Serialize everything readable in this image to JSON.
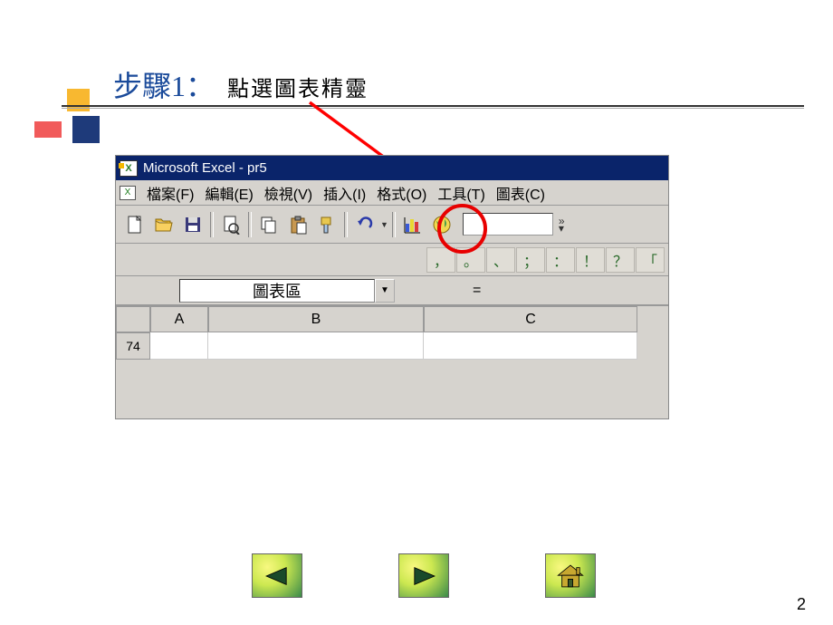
{
  "title": {
    "step": "步驟1：",
    "desc": "點選圖表精靈"
  },
  "excel": {
    "titlebar": "Microsoft Excel - pr5",
    "menu": [
      "檔案(F)",
      "編輯(E)",
      "檢視(V)",
      "插入(I)",
      "格式(O)",
      "工具(T)",
      "圖表(C)"
    ],
    "symbols": [
      "，",
      "。",
      "、",
      "；",
      "：",
      "！",
      "？",
      "「"
    ],
    "namebox": "圖表區",
    "formula_eq": "=",
    "columns": [
      "A",
      "B",
      "C"
    ],
    "row_number": "74"
  },
  "page_number": "2",
  "icons": {
    "new": "new-file-icon",
    "open": "open-folder-icon",
    "save": "save-disk-icon",
    "print_preview": "print-preview-icon",
    "copy": "copy-icon",
    "paste": "paste-icon",
    "format_painter": "format-painter-icon",
    "undo": "undo-icon",
    "chart_wizard": "chart-wizard-icon",
    "map": "map-icon"
  }
}
